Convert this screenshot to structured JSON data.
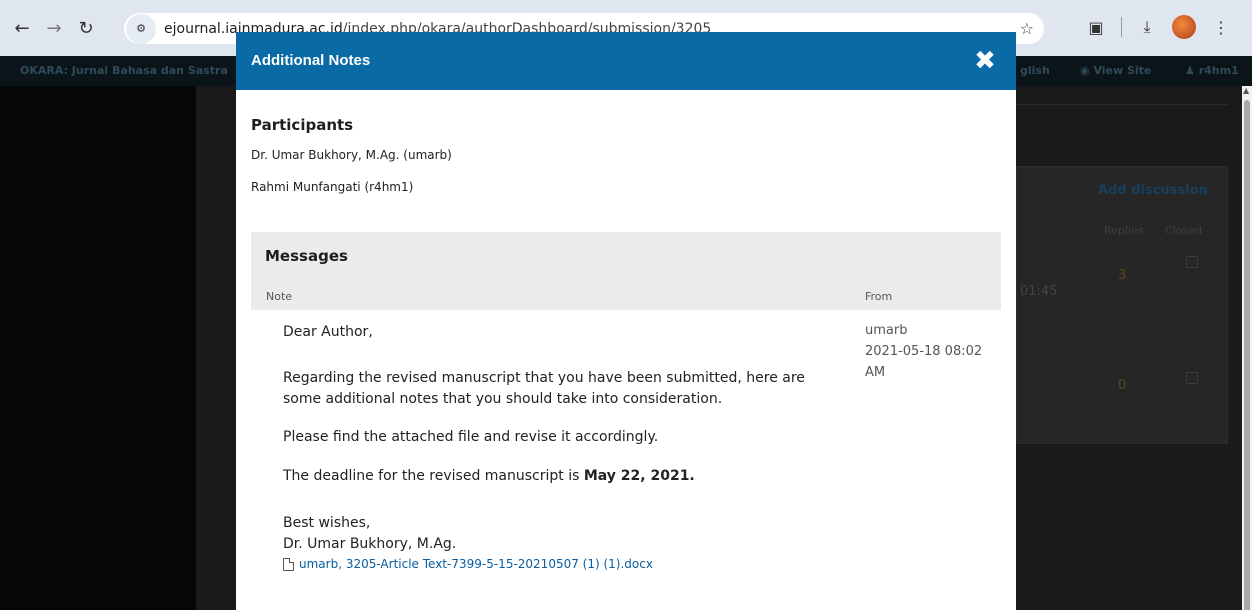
{
  "browser": {
    "url_domain": "ejournal.iainmadura.ac.id",
    "url_path": "/index.php/okara/authorDashboard/submission/3205",
    "icons": [
      "back-icon",
      "forward-icon",
      "reload-icon",
      "site-info-icon",
      "star-icon",
      "extensions-icon",
      "download-icon",
      "profile-avatar",
      "menu-icon"
    ]
  },
  "app_header": {
    "brand": "OKARA: Jurnal Bahasa dan Sastra",
    "language": "glish",
    "view_site": "View Site",
    "user": "r4hm1"
  },
  "background": {
    "add_discussion": "Add discussion",
    "replies_header": "Replies",
    "closed_header": "Closed",
    "row1_time": "01:45",
    "row1_replies": "3",
    "row2_replies": "0"
  },
  "modal": {
    "title": "Additional Notes",
    "participants_title": "Participants",
    "participants": [
      "Dr. Umar Bukhory, M.Ag. (umarb)",
      "Rahmi Munfangati (r4hm1)"
    ],
    "messages_title": "Messages",
    "columns": {
      "note": "Note",
      "from": "From"
    },
    "message": {
      "greeting": "Dear Author,",
      "para1_line1": "Regarding the revised manuscript that you have been submitted, here are",
      "para1_line2": "some additional notes that you should take into consideration.",
      "para2": "Please find the attached file and revise it accordingly.",
      "para3_prefix": "The deadline for the revised manuscript is ",
      "para3_bold": "May 22, 2021.",
      "closing": "Best wishes,",
      "signature": "Dr. Umar Bukhory, M.Ag.",
      "from_user": "umarb",
      "from_date": "2021-05-18 08:02",
      "from_ampm": "AM",
      "attachment": "umarb, 3205-Article Text-7399-5-15-20210507 (1) (1).docx"
    }
  },
  "colors": {
    "modal_header": "#0a6aa6",
    "link": "#0a5ea0"
  }
}
